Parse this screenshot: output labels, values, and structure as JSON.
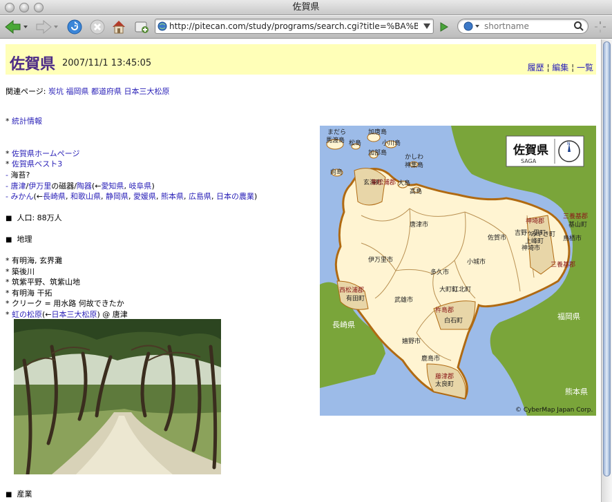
{
  "window": {
    "title": "佐賀県"
  },
  "toolbar": {
    "url": "http://pitecan.com/study/programs/search.cgi?title=%BA%B4%",
    "search_placeholder": "shortname"
  },
  "page": {
    "title": "佐賀県",
    "date": "2007/11/1 13:45:05",
    "header_links": [
      "履歴",
      "編集",
      "一覧"
    ],
    "related_label": "関連ページ:",
    "related": [
      "炭坑",
      "福岡県",
      "都道府県",
      "日本三大松原"
    ],
    "stats_link": "統計情報",
    "home_link": "佐賀県ホームページ",
    "best3_link": "佐賀県ベスト3",
    "nori": "海苔?",
    "ceramics": {
      "a": "唐津",
      "sep1": "/",
      "b": "伊万里",
      "mid": "の磁器/",
      "c": "陶器",
      "open": "(←",
      "d": "愛知県",
      "comma": ", ",
      "e": "岐阜県",
      "close": ")"
    },
    "mikan": {
      "a": "みかん",
      "open": "(←",
      "items": [
        "長崎県",
        "和歌山県",
        "静岡県",
        "愛媛県",
        "熊本県",
        "広島県",
        "日本の農業"
      ],
      "close": ")"
    },
    "population": "人口: 88万人",
    "geo_heading": "地理",
    "geo_items": [
      "有明海, 玄界灘",
      "築後川",
      "筑紫平野、筑紫山地",
      "有明海 干拓",
      "クリーク = 用水路 何故できたか"
    ],
    "nijinomatsubara": {
      "a": "虹の松原",
      "open": "(←",
      "b": "日本三大松原",
      "close": ") @ 唐津"
    },
    "industry_heading": "産業"
  },
  "map": {
    "badge_title": "佐賀県",
    "badge_sub": "SAGA",
    "copyright": "© CyberMap Japan Corp.",
    "prefectures": [
      "長崎県",
      "福岡県",
      "熊本県"
    ],
    "islands": [
      "まだら",
      "馬渡島",
      "加唐島",
      "松島",
      "小川島",
      "加部島",
      "かしわ",
      "神集島",
      "向島",
      "高島",
      "大島"
    ],
    "municipalities": [
      "唐津市",
      "伊万里市",
      "多久市",
      "小城市",
      "佐賀市",
      "神埼市",
      "吉野ヶ里町",
      "みやき町",
      "上峰町",
      "基山町",
      "鳥栖市",
      "武雄市",
      "大町町",
      "江北町",
      "白石町",
      "嬉野市",
      "鹿島市",
      "太良町",
      "有田町",
      "玄海町"
    ],
    "districts": [
      "東松浦郡",
      "神埼郡",
      "三養基郡",
      "西松浦郡",
      "杵島郡",
      "藤津郡"
    ],
    "colors": {
      "sea": "#9cbbe8",
      "land": "#7aa53a",
      "saga": "#fff4d2",
      "border": "#b06a12"
    }
  }
}
